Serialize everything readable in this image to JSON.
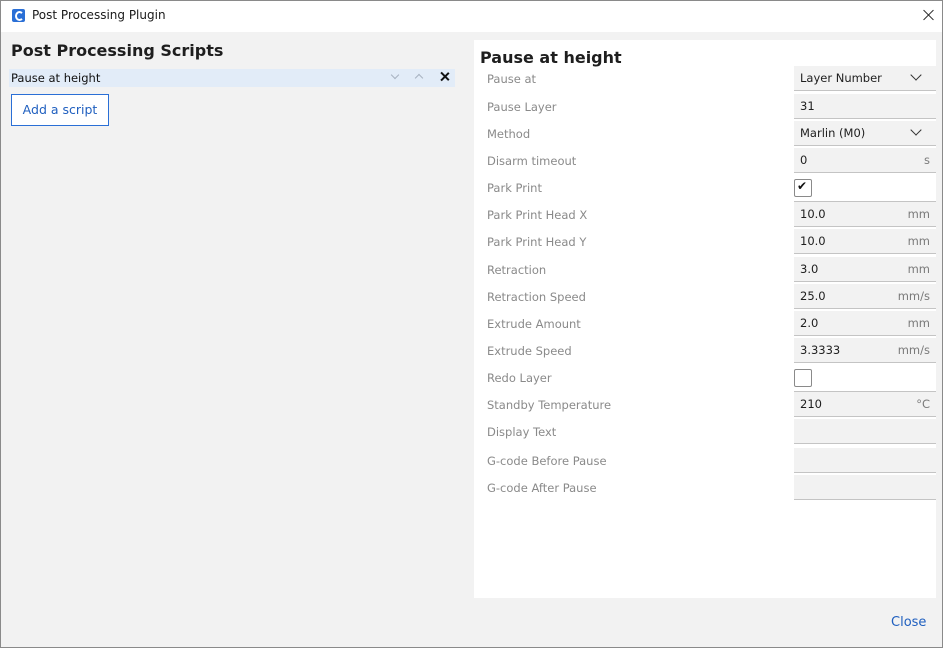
{
  "window": {
    "title": "Post Processing Plugin"
  },
  "left": {
    "title": "Post Processing Scripts",
    "scripts": [
      {
        "label": "Pause at height"
      }
    ],
    "add_button": "Add a script"
  },
  "panel": {
    "title": "Pause at height",
    "settings": [
      {
        "label": "Pause at",
        "type": "dropdown",
        "value": "Layer Number"
      },
      {
        "label": "Pause Layer",
        "type": "number",
        "value": "31",
        "unit": ""
      },
      {
        "label": "Method",
        "type": "dropdown",
        "value": "Marlin (M0)"
      },
      {
        "label": "Disarm timeout",
        "type": "number",
        "value": "0",
        "unit": "s"
      },
      {
        "label": "Park Print",
        "type": "checkbox",
        "checked": true,
        "mark": "✔"
      },
      {
        "label": "Park Print Head X",
        "type": "number",
        "value": "10.0",
        "unit": "mm"
      },
      {
        "label": "Park Print Head Y",
        "type": "number",
        "value": "10.0",
        "unit": "mm"
      },
      {
        "label": "Retraction",
        "type": "number",
        "value": "3.0",
        "unit": "mm"
      },
      {
        "label": "Retraction Speed",
        "type": "number",
        "value": "25.0",
        "unit": "mm/s"
      },
      {
        "label": "Extrude Amount",
        "type": "number",
        "value": "2.0",
        "unit": "mm"
      },
      {
        "label": "Extrude Speed",
        "type": "number",
        "value": "3.3333",
        "unit": "mm/s"
      },
      {
        "label": "Redo Layer",
        "type": "checkbox",
        "checked": false,
        "mark": ""
      },
      {
        "label": "Standby Temperature",
        "type": "number",
        "value": "210",
        "unit": "°C"
      },
      {
        "label": "Display Text",
        "type": "text",
        "value": ""
      },
      {
        "label": "G-code Before Pause",
        "type": "text",
        "value": ""
      },
      {
        "label": "G-code After Pause",
        "type": "text",
        "value": ""
      }
    ]
  },
  "footer": {
    "close_label": "Close"
  },
  "colors": {
    "accent": "#2a6fd6",
    "selected_row": "#e2ecf8",
    "label_gray": "#8a8a8a"
  }
}
